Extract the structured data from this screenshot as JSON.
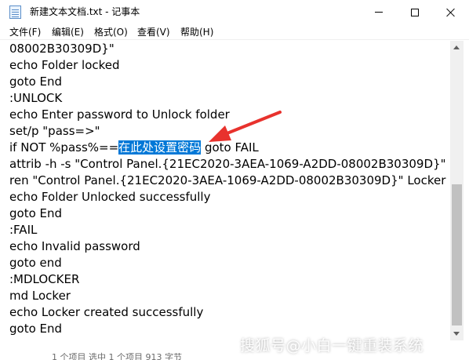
{
  "window": {
    "title": "新建文本文档.txt - 记事本",
    "icon": "notepad-icon"
  },
  "menu": [
    "文件(F)",
    "编辑(E)",
    "格式(O)",
    "查看(V)",
    "帮助(H)"
  ],
  "editor": {
    "lines": [
      "08002B30309D}\"",
      "echo Folder locked",
      "goto End",
      ":UNLOCK",
      "echo Enter password to Unlock folder",
      "set/p \"pass=>\"",
      "if NOT %pass%==",
      "attrib -h -s \"Control Panel.{21EC2020-3AEA-1069-A2DD-08002B30309D}\"",
      "ren \"Control Panel.{21EC2020-3AEA-1069-A2DD-08002B30309D}\" Locker",
      "echo Folder Unlocked successfully",
      "goto End",
      ":FAIL",
      "echo Invalid password",
      "goto end",
      ":MDLOCKER",
      "md Locker",
      "echo Locker created successfully",
      "goto End"
    ],
    "selected_text": "在此处设置密码",
    "after_selection": " goto FAIL",
    "selection_color": "#0078d7"
  },
  "annotation": {
    "arrow_color": "#e8322d"
  },
  "statusbar": {
    "text": "1 个项目    选中 1 个项目  913 字节"
  },
  "watermark": {
    "text": "搜狐号@小白一键重装系统"
  }
}
